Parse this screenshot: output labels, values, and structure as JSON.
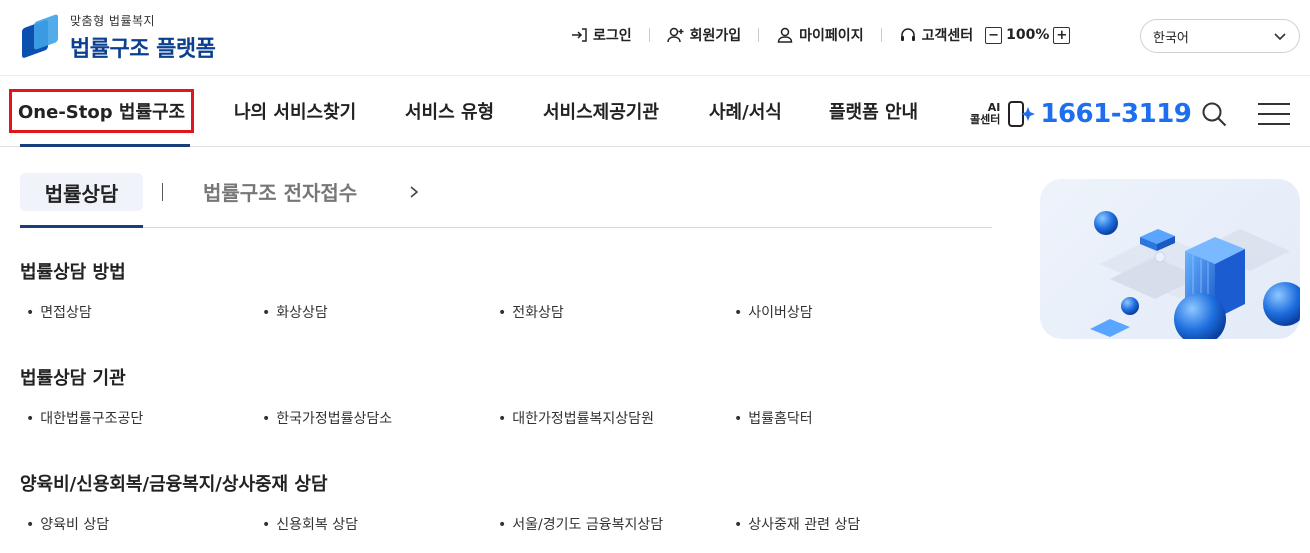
{
  "logo": {
    "subtitle": "맞춤형 법률복지",
    "title": "법률구조 플랫폼"
  },
  "util": {
    "login": "로그인",
    "signup": "회원가입",
    "mypage": "마이페이지",
    "support": "고객센터",
    "zoom_minus": "−",
    "zoom_level": "100%",
    "zoom_plus": "+"
  },
  "language": {
    "selected": "한국어"
  },
  "nav": {
    "items": [
      "One-Stop 법률구조",
      "나의 서비스찾기",
      "서비스 유형",
      "서비스제공기관",
      "사례/서식",
      "플랫폼 안내"
    ],
    "callcenter_ai": "AI",
    "callcenter_label": "콜센터",
    "callcenter_number": "1661-3119"
  },
  "tabs": {
    "active": "법률상담",
    "other": "법률구조 전자접수"
  },
  "sections": [
    {
      "title": "법률상담 방법",
      "links": [
        "면접상담",
        "화상상담",
        "전화상담",
        "사이버상담"
      ]
    },
    {
      "title": "법률상담 기관",
      "links": [
        "대한법률구조공단",
        "한국가정법률상담소",
        "대한가정법률복지상담원",
        "법률홈닥터"
      ]
    },
    {
      "title": "양육비/신용회복/금융복지/상사중재 상담",
      "links": [
        "양육비 상담",
        "신용회복 상담",
        "서울/경기도 금융복지상담",
        "상사중재 관련 상담"
      ]
    }
  ],
  "colors": {
    "accent": "#1d6ff0",
    "brand": "#0b3f8f",
    "highlight": "#e0161e"
  }
}
